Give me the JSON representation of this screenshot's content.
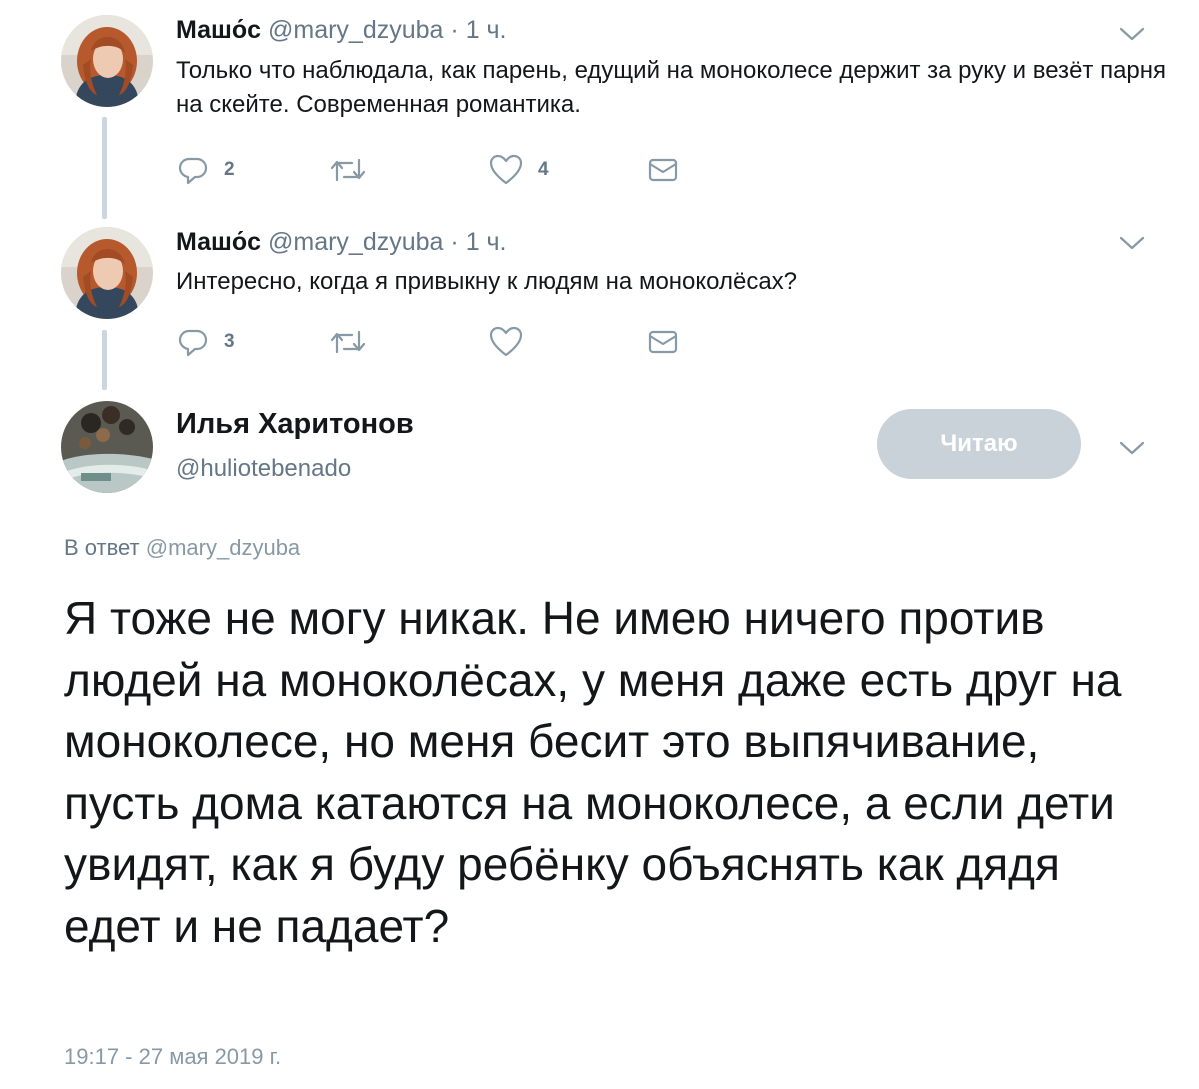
{
  "tweets": [
    {
      "name": "Машо́с",
      "handle": "@mary_dzyuba",
      "separator": "·",
      "time": "1 ч.",
      "text": "Только что наблюдала, как парень, едущий на моноколесе держит за руку и везёт парня на скейте. Современная романтика.",
      "reply_count": "2",
      "retweet_count": "",
      "like_count": "4"
    },
    {
      "name": "Машо́с",
      "handle": "@mary_dzyuba",
      "separator": "·",
      "time": "1 ч.",
      "text": "Интересно, когда я привыкну к людям на моноколёсах?",
      "reply_count": "3",
      "retweet_count": "",
      "like_count": ""
    }
  ],
  "main_tweet": {
    "name": "Илья Харитонов",
    "handle": "@huliotebenado",
    "follow_label": "Читаю",
    "reply_prefix": "В ответ",
    "reply_handle": "@mary_dzyuba",
    "text": "Я тоже не могу никак. Не имею ничего против людей на моноколёсах, у меня даже есть друг на моноколесе, но меня бесит это выпячивание, пусть дома катаются на моноколесе, а если дети увидят, как я буду ребёнку объяснять как дядя едет и не падает?",
    "timestamp": "19:17 - 27 мая 2019 г."
  },
  "icons": {
    "reply": "reply-icon",
    "retweet": "retweet-icon",
    "like": "heart-icon",
    "dm": "envelope-icon",
    "menu": "chevron-down-icon"
  },
  "colors": {
    "text": "#14171a",
    "secondary": "#657786",
    "icon": "#8899a6",
    "thread_line": "#ccd6dd",
    "follow_button": "#c9d2d9"
  }
}
